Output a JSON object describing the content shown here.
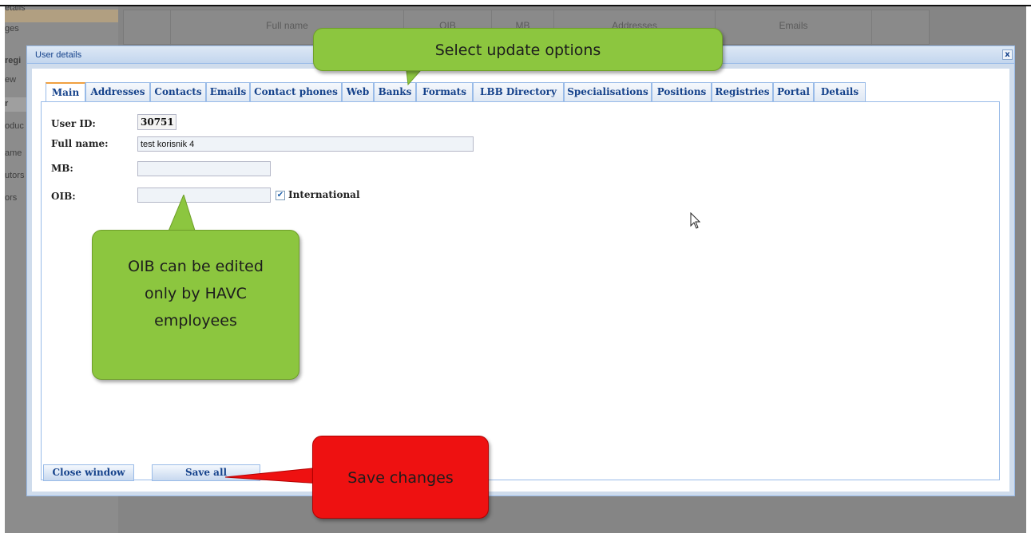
{
  "background": {
    "sidebar": [
      "etails",
      "ges",
      "regi",
      "ew",
      "r",
      "oduc",
      "ame",
      "utors",
      "ors"
    ],
    "grid_columns": [
      "",
      "Full name",
      "OIB",
      "MB",
      "Addresses",
      "Emails",
      ""
    ]
  },
  "dialog": {
    "title": "User details",
    "close_symbol": "x",
    "tabs": [
      "Main",
      "Addresses",
      "Contacts",
      "Emails",
      "Contact phones",
      "Web",
      "Banks",
      "Formats",
      "LBB Directory",
      "Specialisations",
      "Positions",
      "Registries",
      "Portal",
      "Details"
    ],
    "active_tab": "Main",
    "form": {
      "user_id_label": "User ID:",
      "user_id_value": "30751",
      "full_name_label": "Full name:",
      "full_name_value": "test korisnik 4",
      "mb_label": "MB:",
      "mb_value": "",
      "oib_label": "OIB:",
      "oib_value": "",
      "international_label": "International",
      "international_checked": true,
      "check_mark": "✔"
    },
    "buttons": {
      "close_window": "Close window",
      "save_all": "Save all"
    }
  },
  "callouts": {
    "tabs_note": "Select update options",
    "oib_note_lines": [
      "OIB can be edited",
      "only by HAVC",
      "employees"
    ],
    "save_note": "Save changes"
  },
  "colors": {
    "green_callout": "#8cc63f",
    "red_callout": "#ee1111",
    "tab_text": "#15428b"
  }
}
